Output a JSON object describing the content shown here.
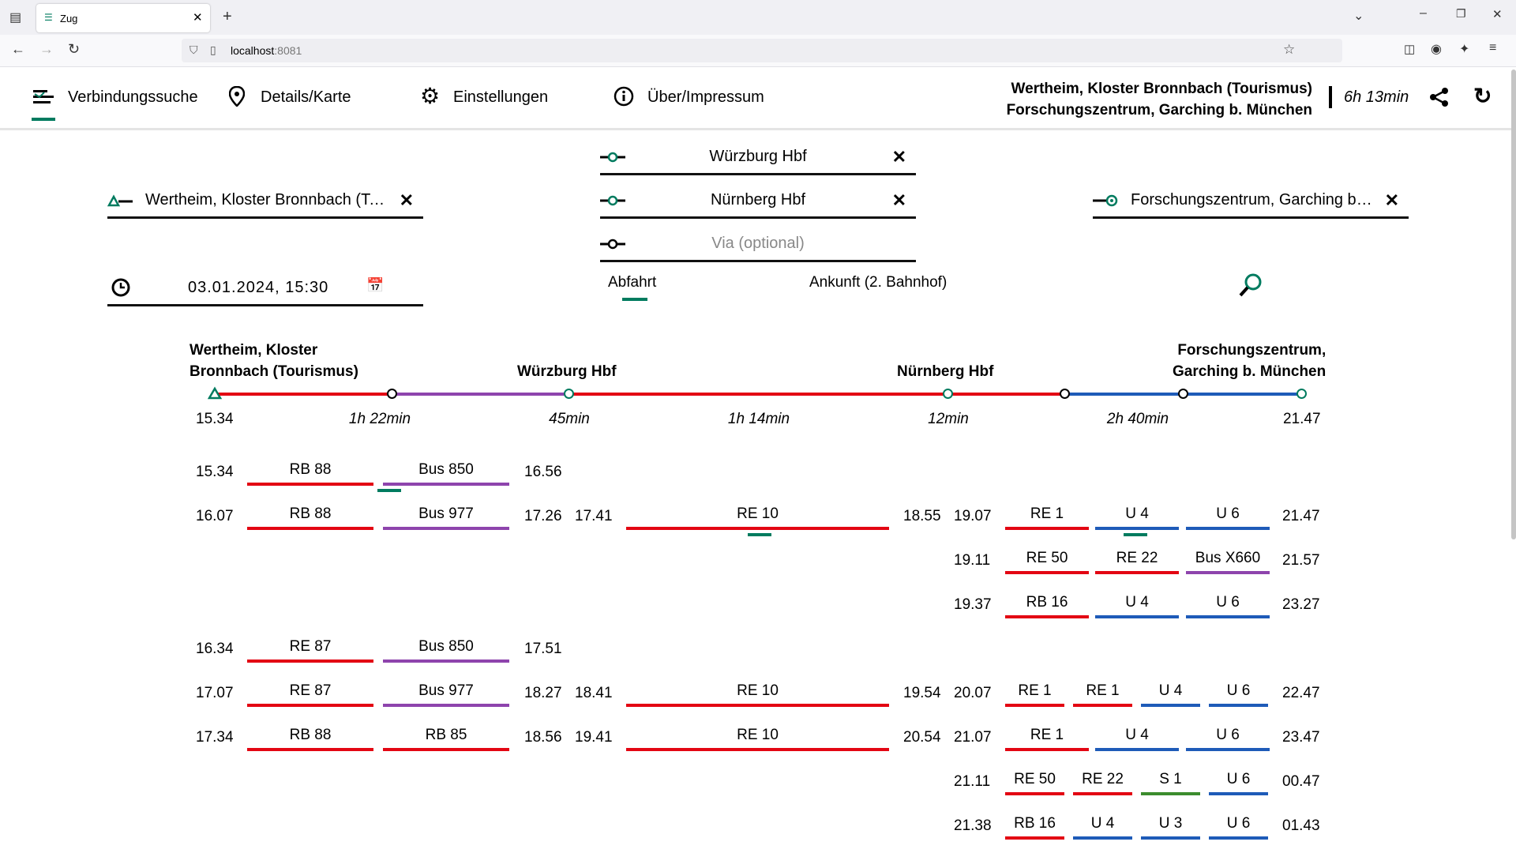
{
  "browser": {
    "tab_title": "Zug",
    "url_host": "localhost",
    "url_port": ":8081"
  },
  "nav": {
    "connections": "Verbindungssuche",
    "details": "Details/Karte",
    "settings": "Einstellungen",
    "about": "Über/Impressum"
  },
  "header": {
    "origin": "Wertheim, Kloster Bronnbach (Tourismus)",
    "destination": "Forschungszentrum, Garching b. München",
    "duration": "6h 13min"
  },
  "search": {
    "origin": "Wertheim, Kloster Bronnbach (To...",
    "via1": "Würzburg Hbf",
    "via2": "Nürnberg Hbf",
    "via_placeholder": "Via (optional)",
    "destination": "Forschungszentrum, Garching b. ...",
    "datetime": "03.01.2024, 15:30",
    "mode_departure": "Abfahrt",
    "mode_arrival": "Ankunft (2. Bahnhof)"
  },
  "summary": {
    "origin_line1": "Wertheim, Kloster",
    "origin_line2": "Bronnbach (Tourismus)",
    "stop2": "Würzburg Hbf",
    "stop3": "Nürnberg Hbf",
    "dest_line1": "Forschungszentrum,",
    "dest_line2": "Garching b. München",
    "dep": "15.34",
    "arr": "21.47",
    "durations": [
      "1h 22min",
      "45min",
      "1h 14min",
      "12min",
      "2h 40min"
    ]
  },
  "colors": {
    "regional": "#e30613",
    "bus": "#8e44ad",
    "ubahn": "#1e5bb8",
    "sbahn": "#3c8c2e",
    "accent": "#007b5f"
  },
  "rows": {
    "r1": {
      "dep": "15.34",
      "l1": "RB 88",
      "l2": "Bus 850",
      "arr": "16.56"
    },
    "r2": {
      "dep": "16.07",
      "l1": "RB 88",
      "l2": "Bus 977",
      "arr": "17.26",
      "dep2": "17.41",
      "l3": "RE 10",
      "arr2": "18.55",
      "dep3": "19.07",
      "l4": "RE 1",
      "l5": "U 4",
      "l6": "U 6",
      "arr3": "21.47"
    },
    "r3": {
      "dep3": "19.11",
      "l4": "RE 50",
      "l5": "RE 22",
      "l6": "Bus X660",
      "arr3": "21.57"
    },
    "r4": {
      "dep3": "19.37",
      "l4": "RB 16",
      "l5": "U 4",
      "l6": "U 6",
      "arr3": "23.27"
    },
    "r5": {
      "dep": "16.34",
      "l1": "RE 87",
      "l2": "Bus 850",
      "arr": "17.51"
    },
    "r6": {
      "dep": "17.07",
      "l1": "RE 87",
      "l2": "Bus 977",
      "arr": "18.27",
      "dep2": "18.41",
      "l3": "RE 10",
      "arr2": "19.54",
      "dep3": "20.07",
      "l4": "RE 1",
      "l5": "RE 1",
      "l6": "U 4",
      "l7": "U 6",
      "arr3": "22.47"
    },
    "r7": {
      "dep": "17.34",
      "l1": "RB 88",
      "l2": "RB 85",
      "arr": "18.56",
      "dep2": "19.41",
      "l3": "RE 10",
      "arr2": "20.54",
      "dep3": "21.07",
      "l4": "RE 1",
      "l5": "U 4",
      "l6": "U 6",
      "arr3": "23.47"
    },
    "r8": {
      "dep3": "21.11",
      "l4": "RE 50",
      "l5": "RE 22",
      "l6": "S 1",
      "l7": "U 6",
      "arr3": "00.47"
    },
    "r9": {
      "dep3": "21.38",
      "l4": "RB 16",
      "l5": "U 4",
      "l6": "U 3",
      "l7": "U 6",
      "arr3": "01.43"
    }
  }
}
